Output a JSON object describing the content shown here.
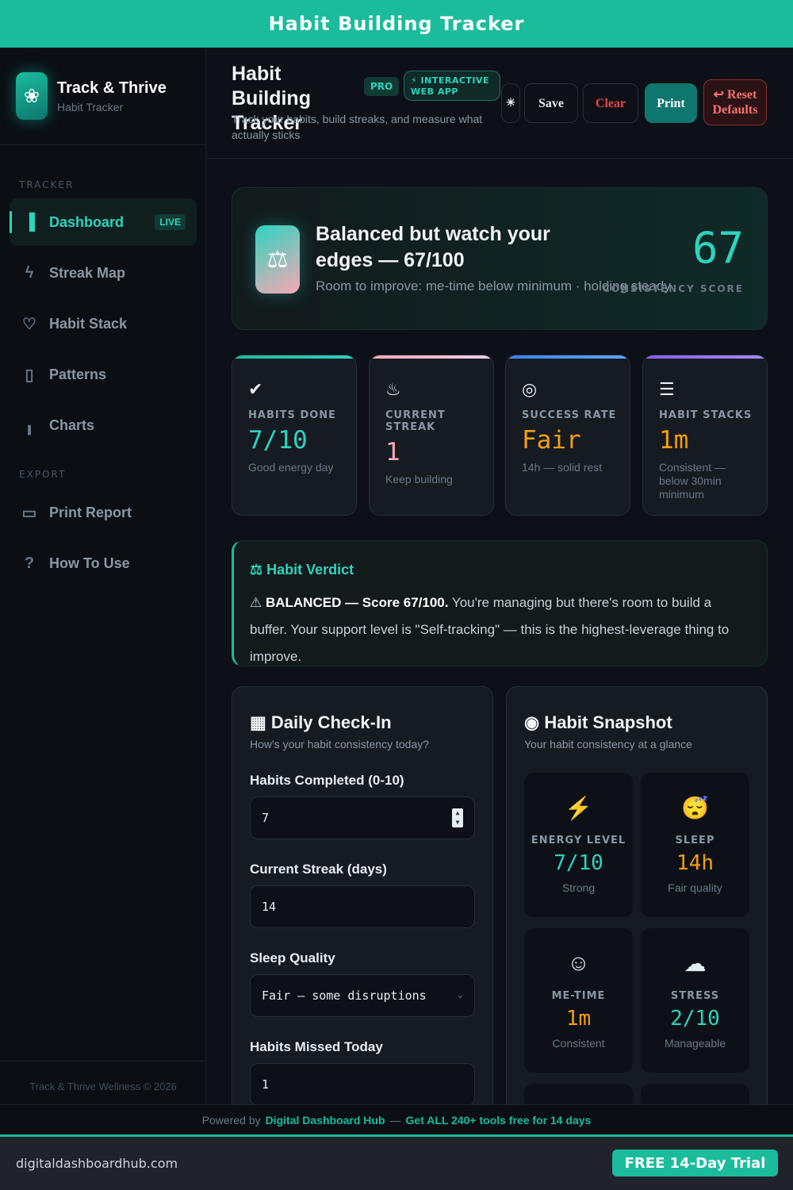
{
  "banner": {
    "title": "Habit Building Tracker"
  },
  "sidebar": {
    "brand": {
      "title": "Track & Thrive",
      "subtitle": "Habit Tracker",
      "icon": "leaf-icon"
    },
    "sections": {
      "tracker": "TRACKER",
      "export": "EXPORT"
    },
    "items": [
      {
        "label": "Dashboard",
        "icon": "bar-chart-icon",
        "badge": "LIVE",
        "active": true
      },
      {
        "label": "Streak Map",
        "icon": "lightning-icon"
      },
      {
        "label": "Habit Stack",
        "icon": "heart-icon"
      },
      {
        "label": "Patterns",
        "icon": "clipboard-icon"
      },
      {
        "label": "Charts",
        "icon": "bar-chart-icon"
      },
      {
        "label": "Print Report",
        "icon": "printer-icon"
      },
      {
        "label": "How To Use",
        "icon": "help-circle-icon"
      }
    ],
    "footer": "Track & Thrive Wellness © 2026"
  },
  "header": {
    "title": "Habit Building Tracker",
    "pro_badge": "PRO",
    "web_badge": "⚡ INTERACTIVE WEB APP",
    "tagline": "Track your habits, build streaks, and measure what actually sticks",
    "buttons": {
      "theme": "☀",
      "save": "Save",
      "clear": "Clear",
      "print": "Print",
      "reset": "↩ Reset Defaults"
    }
  },
  "hero": {
    "title": "Balanced but watch your edges — 67/100",
    "subtitle": "Room to improve: me-time below minimum · holding steady",
    "score": "67",
    "score_label": "CONSISTENCY SCORE"
  },
  "stats": [
    {
      "label": "HABITS DONE",
      "value": "7/10",
      "note": "Good energy day",
      "color": "#2dd4bf"
    },
    {
      "label": "CURRENT STREAK",
      "value": "1",
      "note": "Keep building",
      "color": "#f9a8b4"
    },
    {
      "label": "SUCCESS RATE",
      "value": "Fair",
      "note": "14h — solid rest",
      "color": "#f59e0b"
    },
    {
      "label": "HABIT STACKS",
      "value": "1m",
      "note": "Consistent — below 30min minimum",
      "color": "#f59e0b"
    }
  ],
  "verdict": {
    "title": "Habit Verdict",
    "bold": "BALANCED — Score 67/100.",
    "body": " You're managing but there's room to build a buffer. Your support level is \"Self-tracking\" — this is the highest-leverage thing to improve."
  },
  "checkin": {
    "title": "Daily Check-In",
    "subtitle": "How's your habit consistency today?",
    "fields": [
      {
        "label": "Habits Completed (0-10)",
        "value": "7"
      },
      {
        "label": "Current Streak (days)",
        "value": "14"
      },
      {
        "label": "Sleep Quality",
        "value": "Fair — some disruptions"
      },
      {
        "label": "Habits Missed Today",
        "value": "1"
      }
    ]
  },
  "snapshot": {
    "title": "Habit Snapshot",
    "subtitle": "Your habit consistency at a glance",
    "cards": [
      {
        "icon": "⚡",
        "label": "ENERGY LEVEL",
        "value": "7/10",
        "note": "Strong",
        "color": "#2dd4bf"
      },
      {
        "icon": "😴",
        "label": "SLEEP",
        "value": "14h",
        "note": "Fair quality",
        "color": "#f59e0b"
      },
      {
        "icon": "",
        "label": "ME-TIME",
        "value": "1m",
        "note": "Consistent",
        "color": "#f59e0b"
      },
      {
        "icon": "",
        "label": "STRESS",
        "value": "2/10",
        "note": "Manageable",
        "color": "#2dd4bf"
      }
    ]
  },
  "powered": {
    "prefix": "Powered by",
    "link": "Digital Dashboard Hub",
    "sep": "—",
    "promo": "Get ALL 240+ tools free for 14 days"
  },
  "footer": {
    "domain": "digitaldashboardhub.com",
    "cta": "FREE 14-Day Trial"
  },
  "colors": {
    "accent": "#1abc9c",
    "teal": "#2dd4bf",
    "amber": "#f59e0b",
    "pink": "#f9a8b4",
    "danger": "#ef4444"
  }
}
